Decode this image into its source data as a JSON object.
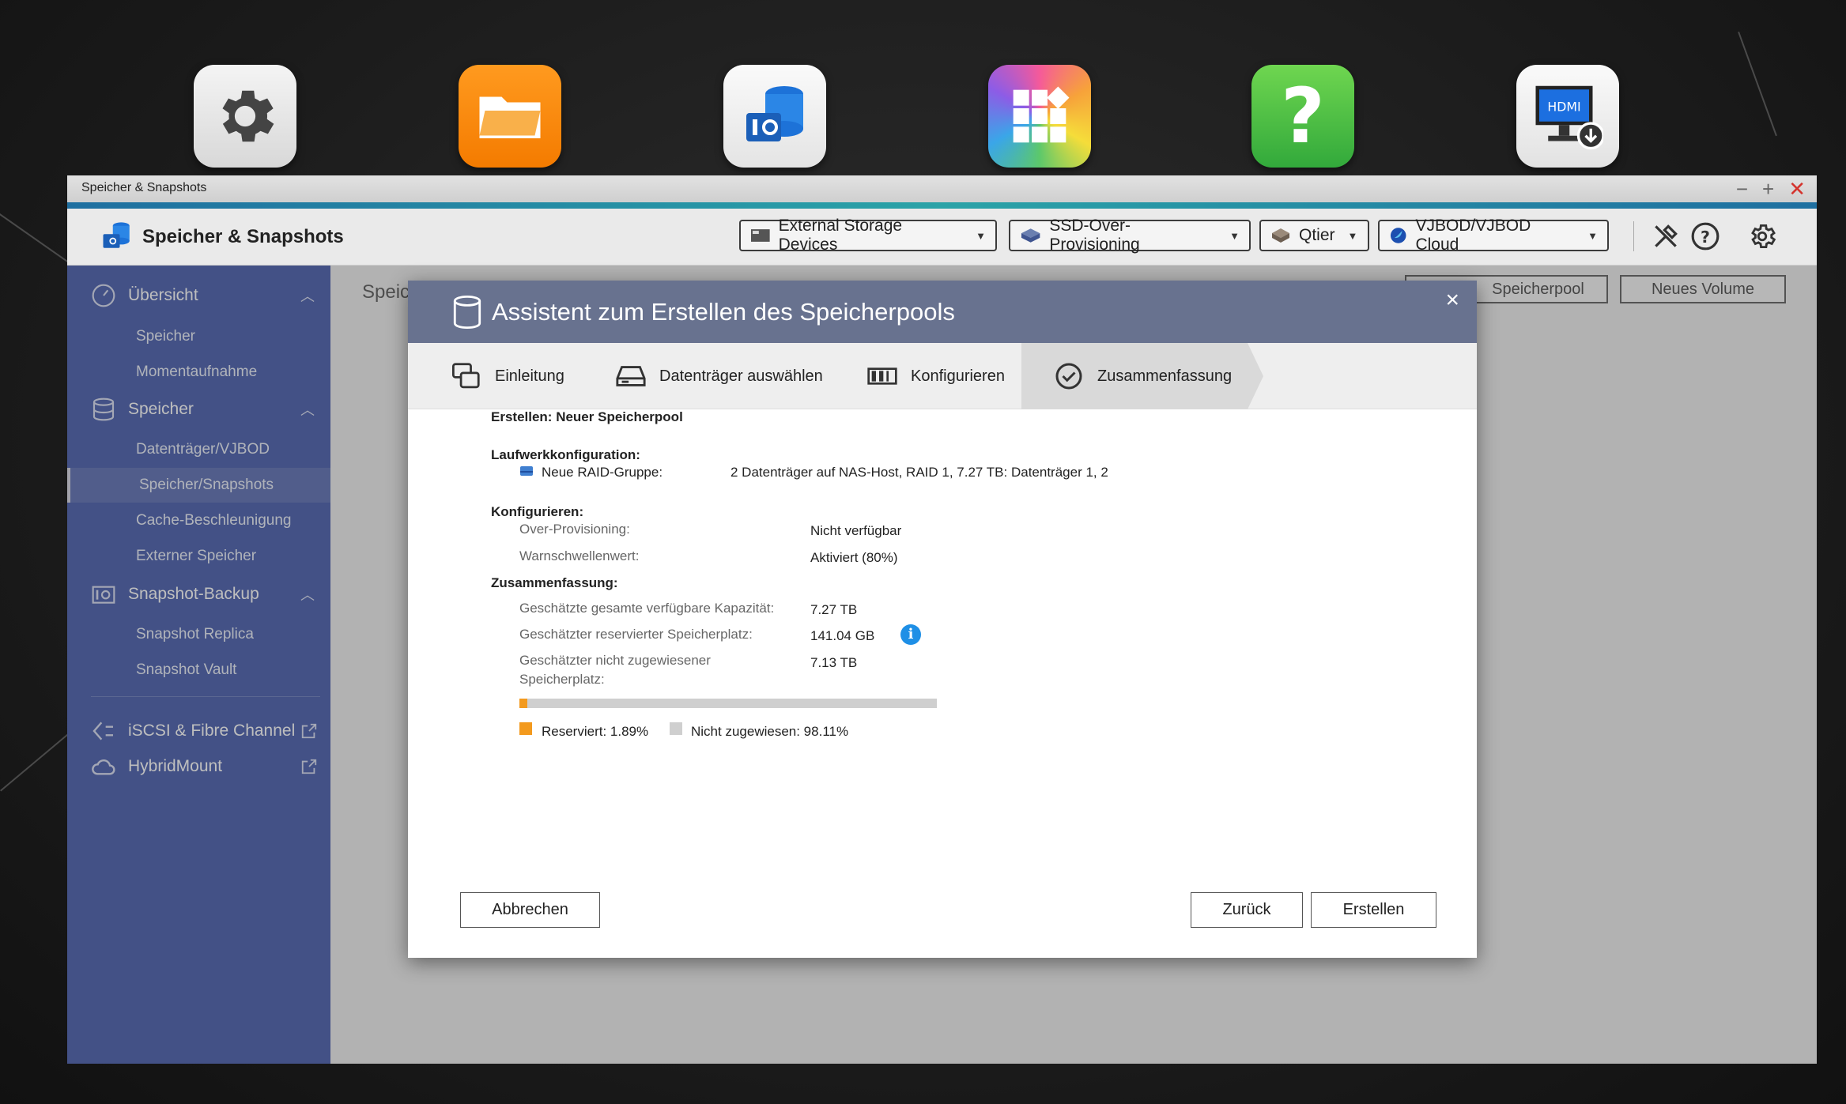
{
  "desktop": {
    "icons": [
      {
        "name": "settings",
        "label": "Systemsteuerung"
      },
      {
        "name": "file-station",
        "label": "File Station"
      },
      {
        "name": "storage-snapshots",
        "label": "Speicher & Snapshots"
      },
      {
        "name": "app-center",
        "label": "App Center"
      },
      {
        "name": "help-center",
        "label": "Hilfecenter"
      },
      {
        "name": "hdmi-display",
        "label": "HDMI-Display-"
      }
    ]
  },
  "window": {
    "title": "Speicher & Snapshots",
    "controls": {
      "minimize": "−",
      "maximize": "+",
      "close": "✕"
    }
  },
  "app": {
    "title": "Speicher & Snapshots",
    "toolbar": {
      "external": "External Storage Devices",
      "ssd": "SSD-Over-Provisioning",
      "qtier": "Qtier",
      "vjbod": "VJBOD/VJBOD Cloud"
    }
  },
  "sidebar": {
    "sections": [
      {
        "label": "Übersicht",
        "items": [
          "Speicher",
          "Momentaufnahme"
        ]
      },
      {
        "label": "Speicher",
        "items": [
          "Datenträger/VJBOD",
          "Speicher/Snapshots",
          "Cache-Beschleunigung",
          "Externer Speicher"
        ]
      },
      {
        "label": "Snapshot-Backup",
        "items": [
          "Snapshot Replica",
          "Snapshot Vault"
        ]
      }
    ],
    "links": {
      "iscsi": "iSCSI & Fibre Channel",
      "hybridmount": "HybridMount"
    },
    "active_item": "Speicher/Snapshots"
  },
  "content": {
    "title": "Speic",
    "btn_pool": "Speicherpool",
    "btn_volume": "Neues Volume"
  },
  "dialog": {
    "title": "Assistent zum Erstellen des Speicherpools",
    "close": "×",
    "steps": [
      "Einleitung",
      "Datenträger auswählen",
      "Konfigurieren",
      "Zusammenfassung"
    ],
    "current_step": "Zusammenfassung",
    "create_line": "Erstellen: Neuer Speicherpool",
    "drive_config_heading": "Laufwerkkonfiguration:",
    "raid_label": "Neue RAID-Gruppe:",
    "raid_value": "2 Datenträger auf NAS-Host, RAID 1, 7.27 TB: Datenträger 1, 2",
    "configure_heading": "Konfigurieren:",
    "op_label": "Over-Provisioning:",
    "op_value": "Nicht verfügbar",
    "warn_label": "Warnschwellenwert:",
    "warn_value": "Aktiviert (80%)",
    "summary_heading": "Zusammenfassung:",
    "cap_label": "Geschätzte gesamte verfügbare Kapazität:",
    "cap_value": "7.27 TB",
    "reserved_label": "Geschätzter reservierter Speicherplatz:",
    "reserved_value": "141.04 GB",
    "unalloc_label_1": "Geschätzter nicht zugewiesener",
    "unalloc_label_2": "Speicherplatz:",
    "unalloc_value": "7.13 TB",
    "reserved_fraction": 0.0189,
    "legend_reserved": "Reserviert: 1.89%",
    "legend_unassigned": "Nicht zugewiesen: 98.11%",
    "btn_cancel": "Abbrechen",
    "btn_back": "Zurück",
    "btn_create": "Erstellen",
    "colors": {
      "reserved": "#f39a1e",
      "unassigned": "#cfcfcf",
      "header": "#68728f"
    }
  }
}
